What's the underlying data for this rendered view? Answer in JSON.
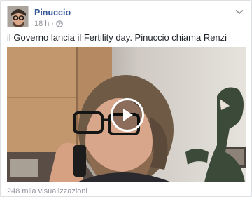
{
  "post": {
    "author": "Pinuccio",
    "time": "18 h",
    "separator": "·",
    "privacy_icon": "globe-icon",
    "text": "il Governo lancia il Fertility day. Pinuccio chiama Renzi",
    "views": "248 mila visualizzazioni"
  },
  "colors": {
    "link_blue": "#365899",
    "meta_grey": "#90949c",
    "text": "#1d2129"
  }
}
